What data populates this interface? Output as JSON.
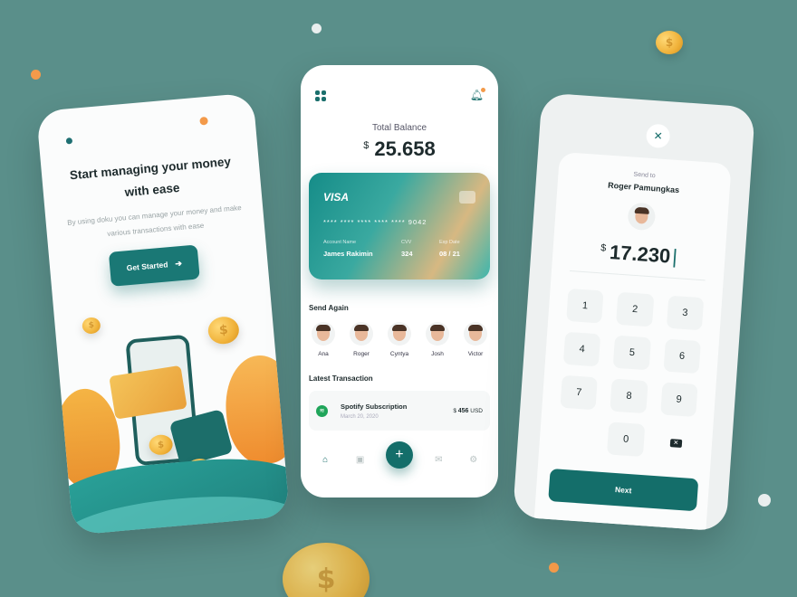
{
  "onboarding": {
    "title": "Start managing your money with ease",
    "subtitle": "By using doku you can manage your money and make various transactions with ease",
    "cta_label": "Get Started"
  },
  "dashboard": {
    "balance_label": "Total Balance",
    "currency": "$",
    "balance": "25.658",
    "card": {
      "brand": "VISA",
      "number": "**** **** **** **** ****  9042",
      "name_label": "Account Name",
      "name": "James Rakimin",
      "cvv_label": "CVV",
      "cvv": "324",
      "exp_label": "Exp Date",
      "exp": "08 / 21"
    },
    "send_again_label": "Send Again",
    "contacts": [
      {
        "name": "Ana"
      },
      {
        "name": "Roger"
      },
      {
        "name": "Cyntya"
      },
      {
        "name": "Josh"
      },
      {
        "name": "Victor"
      }
    ],
    "latest_label": "Latest Transaction",
    "transaction": {
      "name": "Spotify Subscription",
      "date": "March 20, 2020",
      "currency": "$",
      "amount": "456",
      "unit": "USD"
    }
  },
  "send": {
    "send_to_label": "Send to",
    "recipient": "Roger Pamungkas",
    "currency": "$",
    "amount": "17.230",
    "keys": [
      "1",
      "2",
      "3",
      "4",
      "5",
      "6",
      "7",
      "8",
      "9",
      "",
      "0",
      ""
    ],
    "next_label": "Next"
  },
  "colors": {
    "background": "#5a8f8a",
    "primary": "#146e6a",
    "accent": "#f39a4a"
  }
}
